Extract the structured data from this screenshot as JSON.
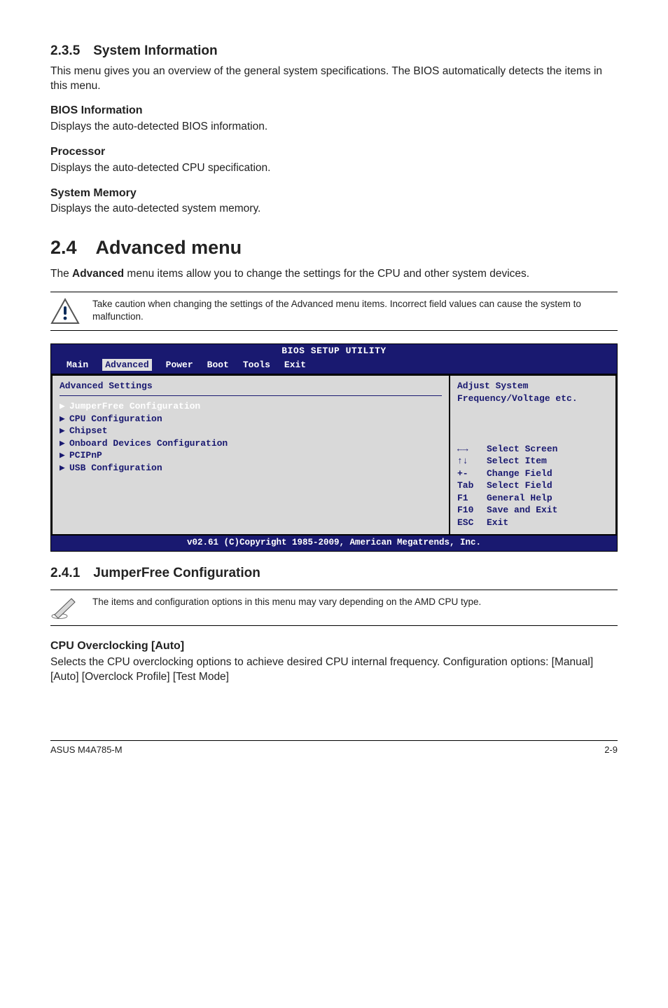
{
  "sec235": {
    "heading": "2.3.5 System Information",
    "intro": "This menu gives you an overview of the general system specifications. The BIOS automatically detects the items in this menu.",
    "bios_info_h": "BIOS Information",
    "bios_info_p": "Displays the auto-detected BIOS information.",
    "proc_h": "Processor",
    "proc_p": "Displays the auto-detected CPU specification.",
    "mem_h": "System Memory",
    "mem_p": "Displays the auto-detected system memory."
  },
  "sec24": {
    "heading": "2.4 Advanced menu",
    "intro_pre": "The ",
    "intro_bold": "Advanced",
    "intro_post": " menu items allow you to change the settings for the CPU and other system devices.",
    "warn": "Take caution when changing the settings of the Advanced menu items. Incorrect field values can cause the system to malfunction."
  },
  "bios": {
    "title": "BIOS SETUP UTILITY",
    "menus": [
      "Main",
      "Advanced",
      "Power",
      "Boot",
      "Tools",
      "Exit"
    ],
    "selected_menu_index": 1,
    "panel_heading": "Advanced Settings",
    "items": [
      "JumperFree Configuration",
      "CPU Configuration",
      "Chipset",
      "Onboard Devices Configuration",
      "PCIPnP",
      "USB Configuration"
    ],
    "selected_item_index": 0,
    "right_desc1": "Adjust System",
    "right_desc2": "Frequency/Voltage etc.",
    "help": [
      {
        "key": "←→",
        "lbl": "Select Screen"
      },
      {
        "key": "↑↓",
        "lbl": "Select Item"
      },
      {
        "key": "+-",
        "lbl": "Change Field"
      },
      {
        "key": "Tab",
        "lbl": "Select Field"
      },
      {
        "key": "F1",
        "lbl": "General Help"
      },
      {
        "key": "F10",
        "lbl": "Save and Exit"
      },
      {
        "key": "ESC",
        "lbl": "Exit"
      }
    ],
    "footer": "v02.61 (C)Copyright 1985-2009, American Megatrends, Inc."
  },
  "sec241": {
    "heading": "2.4.1 JumperFree Configuration",
    "note": "The items and configuration options in this menu may vary depending on the AMD CPU type.",
    "ovc_h": "CPU Overclocking [Auto]",
    "ovc_p": "Selects the CPU overclocking options to achieve desired CPU internal frequency. Configuration options: [Manual] [Auto] [Overclock Profile] [Test Mode]"
  },
  "footer": {
    "left": "ASUS M4A785-M",
    "right": "2-9"
  }
}
